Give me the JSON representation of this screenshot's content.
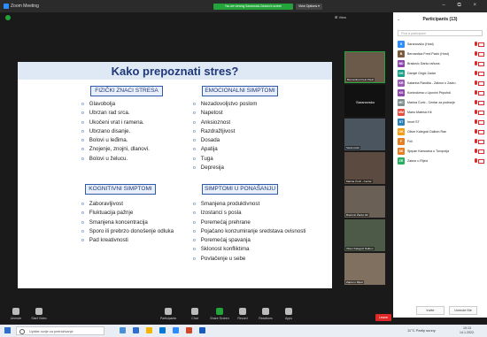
{
  "window": {
    "app_title": "Zoom Meeting",
    "share_banner": "You are viewing Saranovski-Zdravko's screen",
    "view_options": "View Options ▾",
    "view_label": "⊞ View",
    "window_controls": "– ⧉ ×"
  },
  "slide": {
    "title": "Kako prepoznati stres?",
    "sections": [
      {
        "heading": "FIZIČKI ZNACI STRESA",
        "items": [
          "Glavobolja",
          "Ubrzan rad srca.",
          "Ukočeni vrat i ramena.",
          "Ubrzano disanje.",
          "Bolovi u leđima.",
          "Znojenje, znojni, dlanovi.",
          "Bolovi u želucu."
        ]
      },
      {
        "heading": "EMOCIONALNI SIMPTOMI",
        "items": [
          "Nezadovoljstvo poslom",
          "Napetost",
          "Anksioznost",
          "Razdražljivost",
          "Dosada",
          "Apatija",
          "Tuga",
          "Depresija"
        ]
      },
      {
        "heading": "KOGNITIVNI SIMPTOMI",
        "items": [
          "Zaboravljivost",
          "Fluktuacija pažnje",
          "Smanjena koncentracija",
          "Sporo ili prebrzo donošenje odluka",
          "Pad kreativnosti"
        ]
      },
      {
        "heading": "SIMPTOMI U PONAŠANJU",
        "items": [
          "Smanjena produktivnost",
          "Izostanci s posla",
          "Poremećaj prehrane",
          "Pojačano konzumiranje sredstava ovisnosti",
          "Poremećaj spavanja",
          "Sklonost konfliktima",
          "Povlačenje u sebe"
        ]
      }
    ]
  },
  "thumbnails": [
    "Bernardica Fresl Pavić",
    "Saranovsko",
    "Saranovski",
    "Marina Ćurić - Centar",
    "Branimir Žanko Ilić",
    "Oliver Kalegoić Dalbon",
    "Zaprei u Rijeci",
    "Fnii",
    "Sjepan Kamovina s Tu..."
  ],
  "participants_panel": {
    "title": "Participants (13)",
    "search_placeholder": "Find a participant",
    "participants": [
      {
        "initials": "S",
        "name": "Saranovsko (Host)",
        "color": "#2d8cff"
      },
      {
        "initials": "B",
        "name": "Bernardica Fresl Pavić (Host)",
        "color": "#7a5c3a"
      },
      {
        "initials": "BD",
        "name": "Brakovic Darko raðuna",
        "color": "#8e44ad"
      },
      {
        "initials": "DG",
        "name": "Damjel Grigić Zadar",
        "color": "#16a085"
      },
      {
        "initials": "KR",
        "name": "Katarina Randša - Zaknor u Zadru",
        "color": "#9b59b6"
      },
      {
        "initials": "KS",
        "name": "Koninskima u Lipovini Pripohdi",
        "color": "#8e44ad"
      },
      {
        "initials": "MC",
        "name": "Marina Ćurić - Centar za podrsnje",
        "color": "#7f8c8d"
      },
      {
        "initials": "MM",
        "name": "Mario Matesic Kit",
        "color": "#e74c3c"
      },
      {
        "initials": "ST",
        "name": "Imort ST",
        "color": "#2980b9"
      },
      {
        "initials": "OK",
        "name": "Oliver Kalegoić Dalbon Ran",
        "color": "#f39c12"
      },
      {
        "initials": "F",
        "name": "Fnii",
        "color": "#e67e22"
      },
      {
        "initials": "SK",
        "name": "Sjepan Kamovina u Turopolja",
        "color": "#e67e22"
      },
      {
        "initials": "ZR",
        "name": "Zakror u Rijeci",
        "color": "#27ae60"
      }
    ],
    "buttons": {
      "invite": "Invite",
      "unmute_all": "Unmute Me"
    }
  },
  "toolbar": {
    "unmute": "Unmute",
    "video": "Start Video",
    "participants": "Participants",
    "chat": "Chat",
    "share": "Share Screen",
    "record": "Record",
    "reactions": "Reactions",
    "apps": "Apps",
    "leave": "Leave"
  },
  "taskbar": {
    "search_placeholder": "Upišite ovdje za pretraživanje",
    "weather": "11°C Partly sunny",
    "time": "10:13",
    "date": "14.1.2022."
  }
}
